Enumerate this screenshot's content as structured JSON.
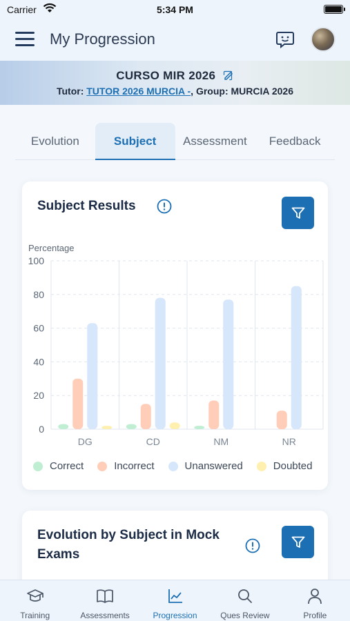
{
  "status_bar": {
    "carrier": "Carrier",
    "time": "5:34 PM"
  },
  "header": {
    "title": "My Progression"
  },
  "course": {
    "title": "CURSO MIR 2026",
    "tutor_label": "Tutor:",
    "tutor_name": "TUTOR 2026 MURCIA -",
    "group_text": ", Group: MURCIA 2026"
  },
  "tabs": [
    {
      "label": "Evolution",
      "active": false
    },
    {
      "label": "Subject",
      "active": true
    },
    {
      "label": "Assessment",
      "active": false
    },
    {
      "label": "Feedback",
      "active": false
    }
  ],
  "subject_results": {
    "title": "Subject Results",
    "y_axis_title": "Percentage"
  },
  "chart_data": {
    "type": "bar",
    "title": "Subject Results",
    "ylabel": "Percentage",
    "xlabel": "",
    "ylim": [
      0,
      100
    ],
    "yticks": [
      0,
      20,
      40,
      60,
      80,
      100
    ],
    "categories": [
      "DG",
      "CD",
      "NM",
      "NR"
    ],
    "series": [
      {
        "name": "Correct",
        "color": "#bfeed3",
        "values": [
          3,
          3,
          2,
          0
        ]
      },
      {
        "name": "Incorrect",
        "color": "#ffcdb8",
        "values": [
          30,
          15,
          17,
          11
        ]
      },
      {
        "name": "Unanswered",
        "color": "#d6e6fb",
        "values": [
          63,
          78,
          77,
          85
        ]
      },
      {
        "name": "Doubted",
        "color": "#fff0b0",
        "values": [
          2,
          4,
          0,
          0
        ]
      }
    ],
    "grid": true,
    "legend_position": "bottom"
  },
  "evolution_card": {
    "title_line1": "Evolution by Subject in Mock",
    "title_line2": "Exams"
  },
  "bottom_nav": [
    {
      "label": "Training",
      "icon": "graduation-cap-icon",
      "active": false
    },
    {
      "label": "Assessments",
      "icon": "book-icon",
      "active": false
    },
    {
      "label": "Progression",
      "icon": "chart-icon",
      "active": true
    },
    {
      "label": "Ques Review",
      "icon": "search-icon",
      "active": false
    },
    {
      "label": "Profile",
      "icon": "person-icon",
      "active": false
    }
  ],
  "colors": {
    "accent": "#1c6fb3",
    "title": "#1b2b45"
  }
}
